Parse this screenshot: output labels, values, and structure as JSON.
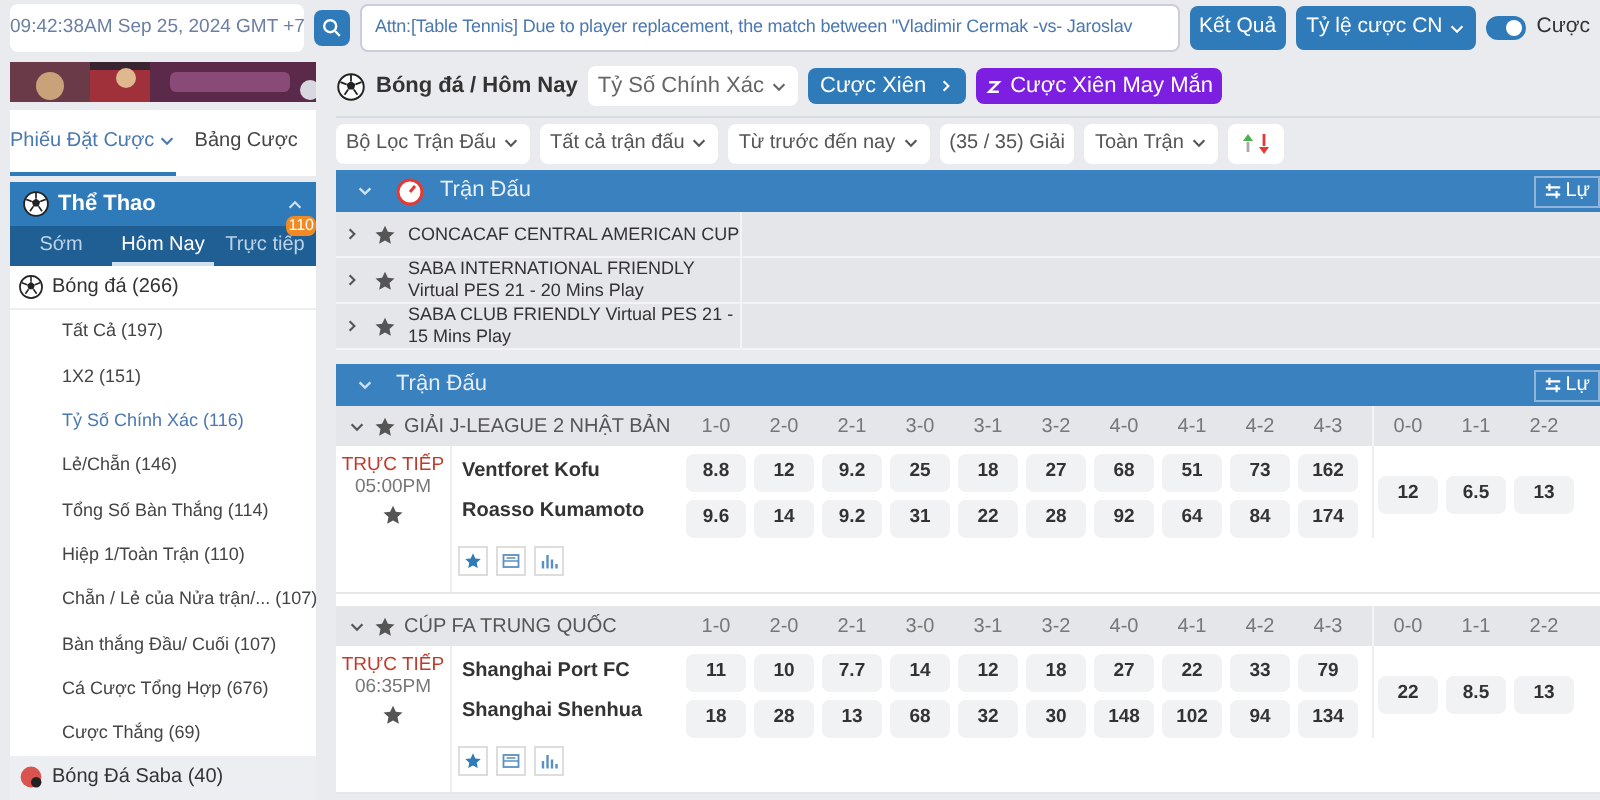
{
  "header": {
    "clock": "09:42:38AM Sep 25, 2024 GMT +7",
    "ticker": "Attn:[Table Tennis] Due to player replacement, the match between \"Vladimir Cermak -vs- Jaroslav",
    "buttons": [
      {
        "label": "Kết Quả",
        "dropdown": false
      },
      {
        "label": "Tỷ lệ cược CN",
        "dropdown": true
      }
    ],
    "toggle": {
      "label": "Cược",
      "on": true
    }
  },
  "sidebar": {
    "tabs": [
      {
        "label": "Phiếu Đặt Cược",
        "selected": true
      },
      {
        "label": "Bảng Cược",
        "selected": false
      }
    ],
    "sports_title": "Thể Thao",
    "period_tabs": [
      {
        "label": "Sớm",
        "selected": false
      },
      {
        "label": "Hôm Nay",
        "selected": true
      },
      {
        "label": "Trực tiếp",
        "selected": false,
        "badge": "110"
      }
    ],
    "sports": [
      {
        "name": "Bóng đá",
        "count": "(266)",
        "children": [
          {
            "label": "Tất Cả",
            "count": "(197)",
            "selected": false
          },
          {
            "label": "1X2",
            "count": "(151)",
            "selected": false
          },
          {
            "label": "Tỷ Số Chính Xác",
            "count": "(116)",
            "selected": true
          },
          {
            "label": "Lẻ/Chẵn",
            "count": "(146)",
            "selected": false
          },
          {
            "label": "Tổng Số Bàn Thắng",
            "count": "(114)",
            "selected": false
          },
          {
            "label": "Hiệp 1/Toàn Trận",
            "count": "(110)",
            "selected": false
          },
          {
            "label": "Chẵn / Lẻ của Nửa trận/...",
            "count": "(107)",
            "selected": false
          },
          {
            "label": "Bàn thắng Đầu/ Cuối",
            "count": "(107)",
            "selected": false
          },
          {
            "label": "Cá Cược Tổng Hợp",
            "count": "(676)",
            "selected": false
          },
          {
            "label": "Cược Thắng",
            "count": "(69)",
            "selected": false
          }
        ]
      },
      {
        "name": "Bóng Đá Saba",
        "count": "(40)"
      }
    ]
  },
  "main": {
    "breadcrumb": "Bóng đá / Hôm Nay",
    "market": "Tỷ Số Chính Xác",
    "parlay": "Cược Xiên",
    "lucky_parlay": "Cược Xiên May Mắn",
    "filters": [
      {
        "label": "Bộ Lọc Trận Đấu",
        "dropdown": true
      },
      {
        "label": "Tất cả trận đấu",
        "dropdown": true
      },
      {
        "label": "Từ trước đến nay",
        "dropdown": true
      },
      {
        "label": "(35 / 35) Giải",
        "dropdown": false
      },
      {
        "label": "Toàn Trận",
        "dropdown": true
      }
    ],
    "outright_section": {
      "title": "Trận Đấu",
      "button": "Lự",
      "leagues": [
        "CONCACAF CENTRAL AMERICAN CUP",
        "SABA INTERNATIONAL FRIENDLY Virtual PES 21 - 20 Mins Play",
        "SABA CLUB FRIENDLY Virtual PES 21 - 15 Mins Play"
      ]
    },
    "match_section": {
      "title": "Trận Đấu",
      "button": "Lự",
      "leagues": [
        {
          "name": "GIẢI J-LEAGUE 2 NHẬT BẢN",
          "columns": [
            "1-0",
            "2-0",
            "2-1",
            "3-0",
            "3-1",
            "3-2",
            "4-0",
            "4-1",
            "4-2",
            "4-3"
          ],
          "draw_columns": [
            "0-0",
            "1-1",
            "2-2"
          ],
          "match": {
            "status": "TRỰC TIẾP",
            "time": "05:00PM",
            "home": "Ventforet Kofu",
            "away": "Roasso Kumamoto",
            "home_odds": [
              "8.8",
              "12",
              "9.2",
              "25",
              "18",
              "27",
              "68",
              "51",
              "73",
              "162"
            ],
            "away_odds": [
              "9.6",
              "14",
              "9.2",
              "31",
              "22",
              "28",
              "92",
              "64",
              "84",
              "174"
            ],
            "draw_odds": [
              "12",
              "6.5",
              "13"
            ]
          }
        },
        {
          "name": "CÚP FA TRUNG QUỐC",
          "columns": [
            "1-0",
            "2-0",
            "2-1",
            "3-0",
            "3-1",
            "3-2",
            "4-0",
            "4-1",
            "4-2",
            "4-3"
          ],
          "draw_columns": [
            "0-0",
            "1-1",
            "2-2"
          ],
          "match": {
            "status": "TRỰC TIẾP",
            "time": "06:35PM",
            "home": "Shanghai Port FC",
            "away": "Shanghai Shenhua",
            "home_odds": [
              "11",
              "10",
              "7.7",
              "14",
              "12",
              "18",
              "27",
              "22",
              "33",
              "79"
            ],
            "away_odds": [
              "18",
              "28",
              "13",
              "68",
              "32",
              "30",
              "148",
              "102",
              "94",
              "134"
            ],
            "draw_odds": [
              "22",
              "8.5",
              "13"
            ]
          }
        }
      ]
    }
  }
}
